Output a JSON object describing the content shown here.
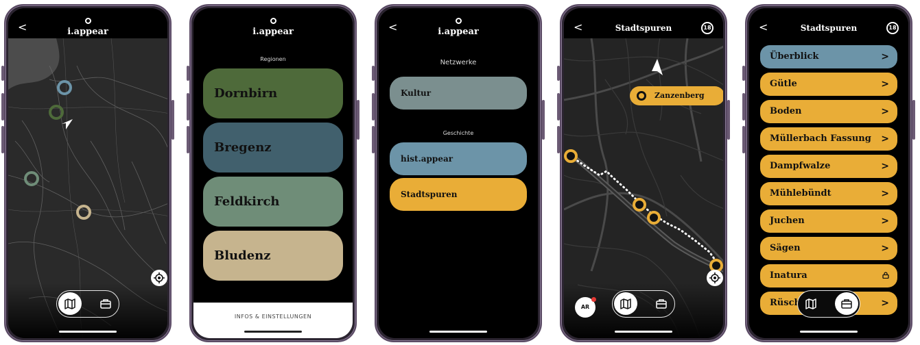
{
  "colors": {
    "green_dark": "#4e6a3a",
    "teal_dark": "#41606d",
    "sage": "#6f8d78",
    "sand": "#c6b48e",
    "slate": "#7b8f8f",
    "steel_blue": "#6c94a8",
    "amber": "#e9ad37",
    "background": "#000000"
  },
  "app": {
    "logo_text": "i.appear"
  },
  "phone1": {
    "back_label": "<",
    "icons": [
      "back-icon",
      "location-icon",
      "map-icon",
      "briefcase-icon"
    ]
  },
  "phone2": {
    "section_label": "Regionen",
    "regions": [
      {
        "label": "Dornbirn",
        "color": "#4e6a3a"
      },
      {
        "label": "Bregenz",
        "color": "#41606d"
      },
      {
        "label": "Feldkirch",
        "color": "#6f8d78"
      },
      {
        "label": "Bludenz",
        "color": "#c6b48e"
      }
    ],
    "footer_label": "INFOS & EINSTELLUNGEN"
  },
  "phone3": {
    "back_label": "<",
    "network_label": "Netzwerke",
    "network_items": [
      {
        "label": "Kultur",
        "color": "#7b8f8f"
      }
    ],
    "history_label": "Geschichte",
    "history_items": [
      {
        "label": "hist.appear",
        "color": "#6c94a8"
      },
      {
        "label": "Stadtspuren",
        "color": "#e9ad37"
      }
    ]
  },
  "phone4": {
    "back_label": "<",
    "title": "Stadtspuren",
    "badge": "18",
    "poi_label": "Zanzenberg",
    "ar_label": "AR"
  },
  "phone5": {
    "back_label": "<",
    "title": "Stadtspuren",
    "badge": "18",
    "items": [
      {
        "label": "Überblick",
        "color": "#6c94a8",
        "locked": false
      },
      {
        "label": "Gütle",
        "color": "#e9ad37",
        "locked": false
      },
      {
        "label": "Boden",
        "color": "#e9ad37",
        "locked": false
      },
      {
        "label": "Müllerbach Fassung",
        "color": "#e9ad37",
        "locked": false
      },
      {
        "label": "Dampfwalze",
        "color": "#e9ad37",
        "locked": false
      },
      {
        "label": "Mühlebündt",
        "color": "#e9ad37",
        "locked": false
      },
      {
        "label": "Juchen",
        "color": "#e9ad37",
        "locked": false
      },
      {
        "label": "Sägen",
        "color": "#e9ad37",
        "locked": false
      },
      {
        "label": "Inatura",
        "color": "#e9ad37",
        "locked": true
      },
      {
        "label": "Rüsch",
        "color": "#e9ad37",
        "locked": false
      }
    ],
    "arrow_glyph": ">"
  }
}
